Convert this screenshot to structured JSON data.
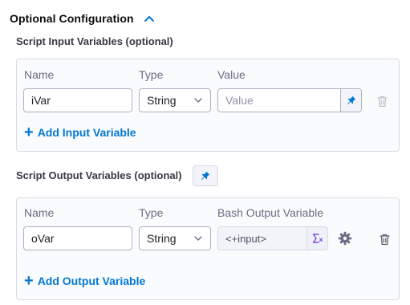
{
  "section": {
    "title": "Optional Configuration"
  },
  "input_vars": {
    "label": "Script Input Variables (optional)",
    "columns": {
      "name": "Name",
      "type": "Type",
      "value": "Value"
    },
    "rows": [
      {
        "name": "iVar",
        "type": "String",
        "value": "",
        "value_placeholder": "Value"
      }
    ],
    "add_label": "Add Input Variable"
  },
  "output_vars": {
    "label": "Script Output Variables (optional)",
    "columns": {
      "name": "Name",
      "type": "Type",
      "value": "Bash Output Variable"
    },
    "rows": [
      {
        "name": "oVar",
        "type": "String",
        "value": "<+input>"
      }
    ],
    "add_label": "Add Output Variable"
  },
  "icons": {
    "chevron": "chevron-up-icon",
    "pin": "pin-icon",
    "delete": "trash-icon",
    "expression": "sigma-icon",
    "settings": "gear-icon"
  },
  "colors": {
    "accent": "#0278d5",
    "border": "#b0b1c4",
    "panel_bg": "#fafbfc"
  }
}
